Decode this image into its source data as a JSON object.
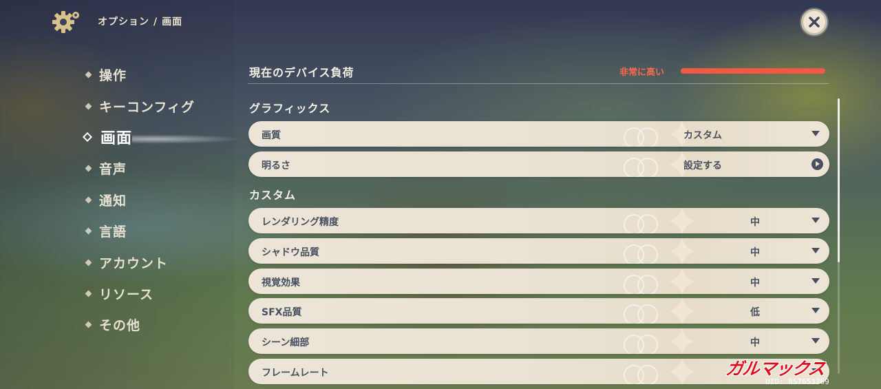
{
  "header": {
    "breadcrumb_parent": "オプション",
    "breadcrumb_separator": "/",
    "breadcrumb_current": "画面",
    "gear_icon": "gear-icon",
    "close_icon": "close-icon"
  },
  "sidebar": {
    "items": [
      {
        "label": "操作",
        "active": false
      },
      {
        "label": "キーコンフィグ",
        "active": false
      },
      {
        "label": "画面",
        "active": true
      },
      {
        "label": "音声",
        "active": false
      },
      {
        "label": "通知",
        "active": false
      },
      {
        "label": "言語",
        "active": false
      },
      {
        "label": "アカウント",
        "active": false
      },
      {
        "label": "リソース",
        "active": false
      },
      {
        "label": "その他",
        "active": false
      }
    ]
  },
  "device_load": {
    "title": "現在のデバイス負荷",
    "status": "非常に高い",
    "level": 1.0,
    "status_color": "#f05a45"
  },
  "graphics": {
    "section_title": "グラフィックス",
    "rows": [
      {
        "label": "画質",
        "value": "カスタム",
        "control": "dropdown"
      },
      {
        "label": "明るさ",
        "value": "設定する",
        "control": "play"
      }
    ]
  },
  "custom": {
    "section_title": "カスタム",
    "rows": [
      {
        "label": "レンダリング精度",
        "value": "中",
        "control": "dropdown"
      },
      {
        "label": "シャドウ品質",
        "value": "中",
        "control": "dropdown"
      },
      {
        "label": "視覚効果",
        "value": "中",
        "control": "dropdown"
      },
      {
        "label": "SFX品質",
        "value": "低",
        "control": "dropdown"
      },
      {
        "label": "シーン細部",
        "value": "中",
        "control": "dropdown"
      },
      {
        "label": "フレームレート",
        "value": "",
        "control": "dropdown"
      }
    ]
  },
  "overlay": {
    "watermark": "ガルマックス",
    "uid": "UID: 857653269"
  }
}
